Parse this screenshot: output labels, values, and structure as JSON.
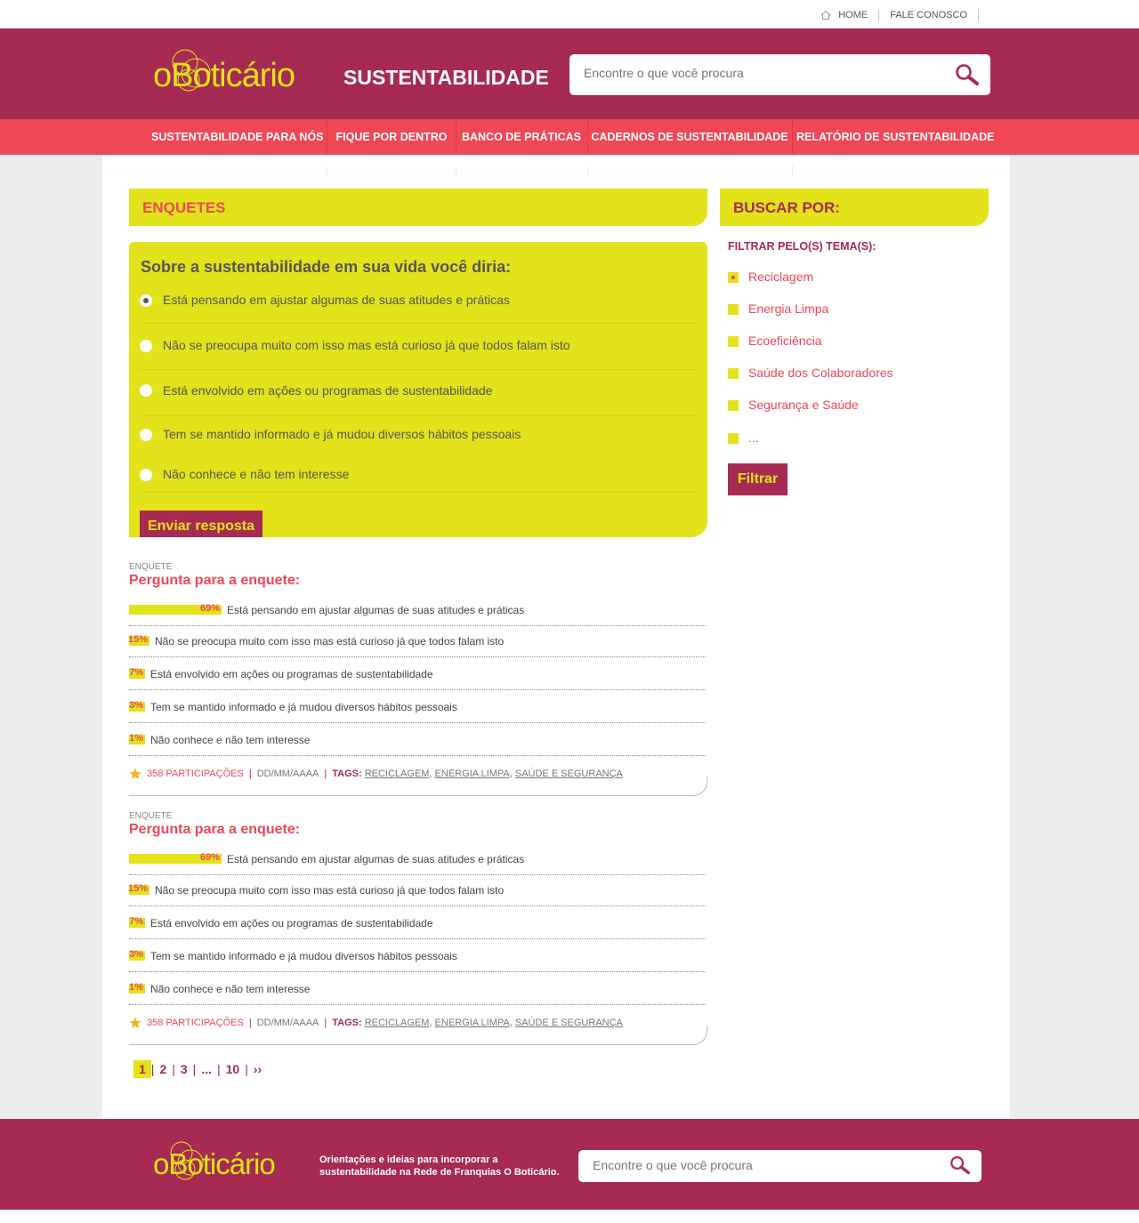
{
  "topbar": {
    "home": "HOME",
    "contact": "FALE CONOSCO"
  },
  "header": {
    "logo_text": "oBoticário",
    "site_title": "SUSTENTABILIDADE",
    "search_placeholder": "Encontre o que você procura"
  },
  "nav": {
    "items": [
      "SUSTENTABILIDADE PARA NÓS",
      "FIQUE POR DENTRO",
      "BANCO DE PRÁTICAS",
      "CADERNOS DE SUSTENTABILIDADE",
      "RELATÓRIO DE SUSTENTABILIDADE"
    ]
  },
  "enquetes": {
    "heading": "ENQUETES",
    "question": "Sobre a sustentabilidade em sua vida você diria:",
    "options": [
      "Está pensando em ajustar algumas de suas atitudes e práticas",
      "Não se preocupa muito com isso mas está curioso já que todos falam isto",
      "Está envolvido em ações ou programas de sustentabilidade",
      "Tem se mantido informado e já mudou diversos hábitos pessoais",
      "Não conhece e não tem interesse"
    ],
    "selected_index": 0,
    "submit_label": "Enviar resposta"
  },
  "results": [
    {
      "kicker": "ENQUETE",
      "title": "Pergunta para a enquete:",
      "rows": [
        {
          "pct": "69%",
          "value": 69,
          "text": "Está pensando em ajustar algumas de suas atitudes e práticas"
        },
        {
          "pct": "15%",
          "value": 15,
          "text": "Não se preocupa muito com isso mas está curioso já que todos falam isto"
        },
        {
          "pct": "7%",
          "value": 7,
          "text": "Está envolvido em ações ou programas de sustentabilidade"
        },
        {
          "pct": "3%",
          "value": 3,
          "text": "Tem se mantido informado e já mudou diversos hábitos pessoais"
        },
        {
          "pct": "1%",
          "value": 1,
          "text": "Não conhece e não tem interesse"
        }
      ],
      "participations": "358 PARTICIPAÇÕES",
      "date": "DD/MM/AAAA",
      "tags_label": "TAGS:",
      "tags": [
        "RECICLAGEM",
        "ENERGIA LIMPA",
        "SAÚDE E SEGURANÇA"
      ]
    },
    {
      "kicker": "ENQUETE",
      "title": "Pergunta para a enquete:",
      "rows": [
        {
          "pct": "69%",
          "value": 69,
          "text": "Está pensando em ajustar algumas de suas atitudes e práticas"
        },
        {
          "pct": "15%",
          "value": 15,
          "text": "Não se preocupa muito com isso mas está curioso já que todos falam isto"
        },
        {
          "pct": "7%",
          "value": 7,
          "text": "Está envolvido em ações ou programas de sustentabilidade"
        },
        {
          "pct": "3%",
          "value": 3,
          "text": "Tem se mantido informado e já mudou diversos hábitos pessoais"
        },
        {
          "pct": "1%",
          "value": 1,
          "text": "Não conhece e não tem interesse"
        }
      ],
      "participations": "358 PARTICIPAÇÕES",
      "date": "DD/MM/AAAA",
      "tags_label": "TAGS:",
      "tags": [
        "RECICLAGEM",
        "ENERGIA LIMPA",
        "SAÚDE E SEGURANÇA"
      ]
    }
  ],
  "pagination": {
    "current": "1",
    "pages": [
      "2",
      "3",
      "...",
      "10",
      "››"
    ]
  },
  "sidebar": {
    "heading": "BUSCAR POR:",
    "filter_label": "FILTRAR PELO(S) TEMA(S):",
    "themes": [
      "Reciclagem",
      "Energia Limpa",
      "Ecoeficiência",
      "Saúde dos Colaboradores",
      "Segurança e Saúde",
      "..."
    ],
    "selected_index": 0,
    "button": "Filtrar"
  },
  "footer": {
    "logo_text": "oBoticário",
    "description": "Orientações e ideias para incorporar a sustentabilidade na Rede de Franquias O Boticário.",
    "search_placeholder": "Encontre o que você procura"
  },
  "colors": {
    "brand": "#a62a51",
    "accent": "#e2e31a",
    "nav": "#ef4756"
  }
}
